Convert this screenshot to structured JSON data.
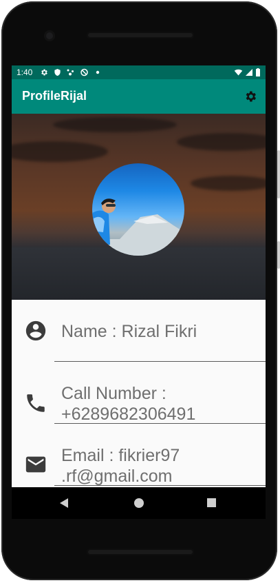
{
  "status_bar": {
    "time": "1:40",
    "icons": [
      "settings-icon",
      "shield-icon",
      "data-saver-icon",
      "vpn-key-icon",
      "dot-icon",
      "wifi-icon",
      "cellular-icon",
      "battery-icon"
    ]
  },
  "app_bar": {
    "title": "ProfileRijal",
    "action_icon": "settings-icon"
  },
  "profile": {
    "name_label": "Name : Rizal Fikri",
    "phone_label_line1": "Call Number :",
    "phone_label_line2": "+6289682306491",
    "email_label_line1": "Email : fikrier97",
    "email_label_line2": ".rf@gmail.com"
  },
  "nav_bar": {
    "buttons": [
      "back-icon",
      "home-icon",
      "recents-icon"
    ]
  },
  "colors": {
    "status_bar": "#00695c",
    "app_bar": "#00897b",
    "text_secondary": "#6f6f6f",
    "icon_dark": "#3c3c3c"
  }
}
